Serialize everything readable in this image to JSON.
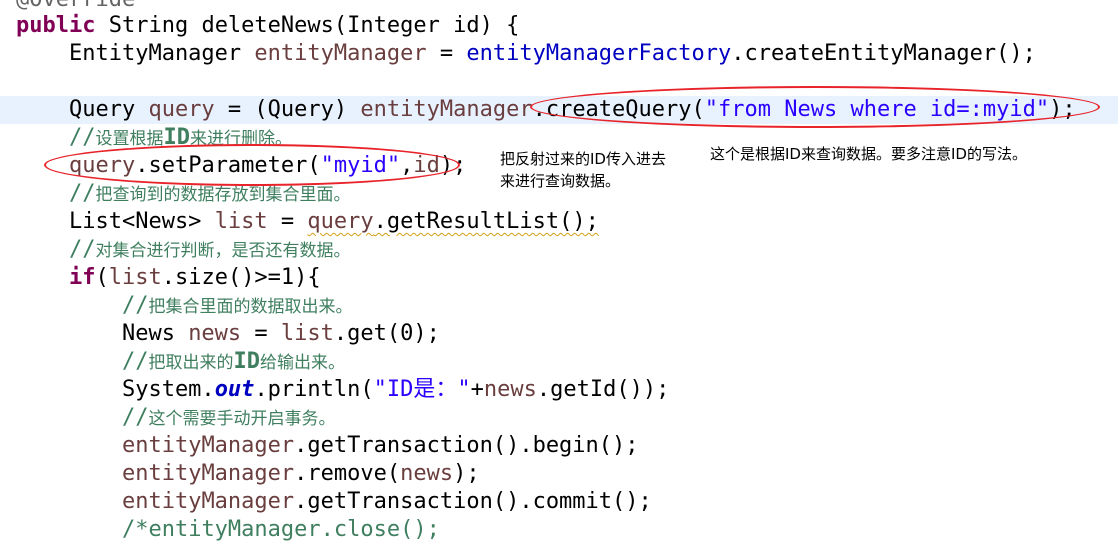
{
  "code": {
    "l00_annotation": "@Override",
    "l01_public": "public",
    "l01_rest": " String deleteNews(Integer id) {",
    "l02_a": "    EntityManager ",
    "l02_var": "entityManager",
    "l02_b": " = ",
    "l02_fld": "entityManagerFactory",
    "l02_c": ".createEntityManager();",
    "l04_a": "    Query ",
    "l04_var": "query",
    "l04_b": " = (Query) ",
    "l04_var2": "entityManager",
    "l04_c": ".createQuery(",
    "l04_str": "\"from News where id=:myid\"",
    "l04_d": ");",
    "l05_indent": "    ",
    "l05_slashes": "//",
    "l05_text": "设置根据",
    "l05_code": "ID",
    "l05_text2": "来进行删除。",
    "l06_indent": "    ",
    "l06_var": "query",
    "l06_a": ".setParameter(",
    "l06_str": "\"myid\"",
    "l06_b": ",",
    "l06_var2": "id",
    "l06_c": ");",
    "l07_indent": "    ",
    "l07_slashes": "//",
    "l07_text": "把查询到的数据存放到集合里面。",
    "l08_a": "    List<News> ",
    "l08_var": "list",
    "l08_b": " = ",
    "l08_var2": "query",
    "l08_c": ".getResultList();",
    "l09_indent": "    ",
    "l09_slashes": "//",
    "l09_text": "对集合进行判断，是否还有数据。",
    "l10_indent": "    ",
    "l10_if": "if",
    "l10_a": "(",
    "l10_var": "list",
    "l10_b": ".size()>=1){",
    "l11_indent": "        ",
    "l11_slashes": "//",
    "l11_text": "把集合里面的数据取出来。",
    "l12_a": "        News ",
    "l12_var": "news",
    "l12_b": " = ",
    "l12_var2": "list",
    "l12_c": ".get(0);",
    "l13_indent": "        ",
    "l13_slashes": "//",
    "l13_text": "把取出来的",
    "l13_code": "ID",
    "l13_text2": "给输出来。",
    "l14_a": "        System.",
    "l14_fld": "out",
    "l14_b": ".println(",
    "l14_str": "\"ID是：\"",
    "l14_c": "+",
    "l14_var": "news",
    "l14_d": ".getId());",
    "l15_indent": "        ",
    "l15_slashes": "//",
    "l15_text": "这个需要手动开启事务。",
    "l16_indent": "        ",
    "l16_var": "entityManager",
    "l16_a": ".getTransaction().begin();",
    "l17_indent": "        ",
    "l17_var": "entityManager",
    "l17_a": ".remove(",
    "l17_var2": "news",
    "l17_b": ");",
    "l18_indent": "        ",
    "l18_var": "entityManager",
    "l18_a": ".getTransaction().commit();",
    "l19_indent": "        ",
    "l19_text": "/*entityManager.close();"
  },
  "notes": {
    "note_right": "这个是根据ID来查询数据。要多注意ID的写法。",
    "note_middle": "把反射过来的ID传入进去\n来进行查询数据。"
  },
  "colors": {
    "keyword": "#7f0055",
    "local_variable": "#6a3e3e",
    "field": "#0000c0",
    "string": "#2a00ff",
    "comment": "#3f7f5f",
    "annotation": "#646464",
    "current_line_highlight": "#e8f2fe",
    "ellipse_markup": "#e8232a"
  }
}
